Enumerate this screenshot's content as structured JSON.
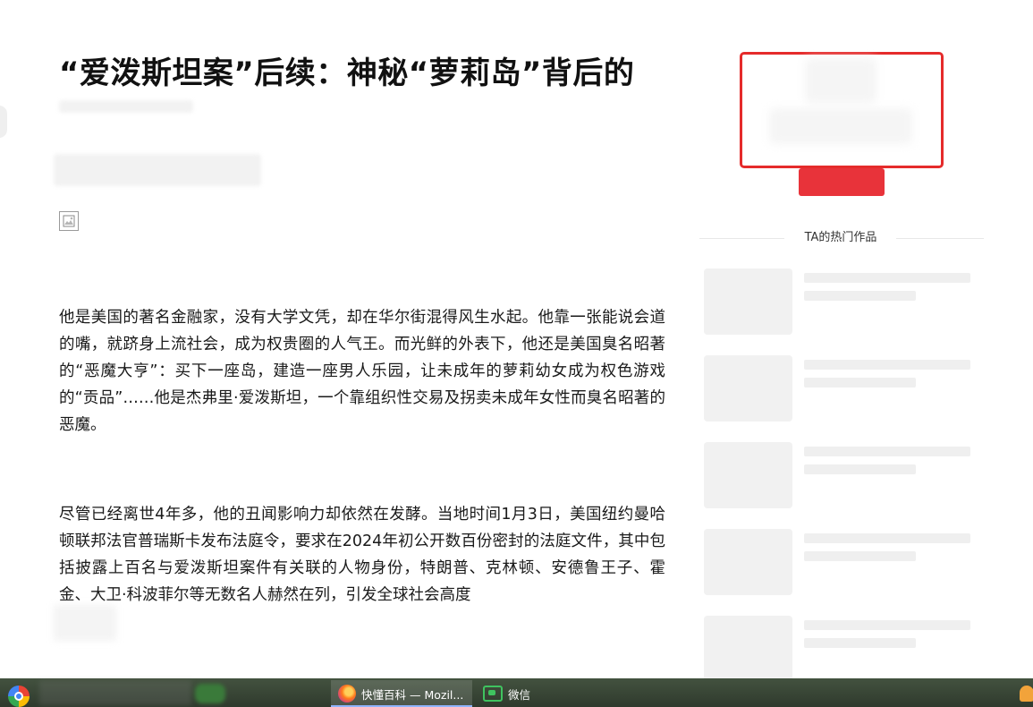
{
  "article": {
    "title": "“爱泼斯坦案”后续：神秘“萝莉岛”背后的",
    "paragraphs": [
      "他是美国的著名金融家，没有大学文凭，却在华尔街混得风生水起。他靠一张能说会道的嘴，就跻身上流社会，成为权贵圈的人气王。而光鲜的外表下，他还是美国臭名昭著的“恶魔大亨”：买下一座岛，建造一座男人乐园，让未成年的萝莉幼女成为权色游戏的“贡品”……他是杰弗里·爱泼斯坦，一个靠组织性交易及拐卖未成年女性而臭名昭著的恶魔。",
      "尽管已经离世4年多，他的丑闻影响力却依然在发酵。当地时间1月3日，美国纽约曼哈顿联邦法官普瑞斯卡发布法庭令，要求在2024年初公开数百份密封的法庭文件，其中包括披露上百名与爱泼斯坦案件有关联的人物身份，特朗普、克林顿、安德鲁王子、霍金、大卫·科波菲尔等无数名人赫然在列，引发全球社会高度"
    ]
  },
  "sidebar": {
    "hot_works_title": "TA的热门作品"
  },
  "taskbar": {
    "firefox_label": "快懂百科 — Mozil...",
    "wechat_label": "微信"
  },
  "colors": {
    "accent_red": "#e8333a",
    "card_border": "#e52b2b",
    "taskbar": "#3a4637"
  },
  "icons": [
    "broken-image-icon",
    "start-icon",
    "firefox-icon",
    "wechat-icon",
    "tray-icon"
  ]
}
